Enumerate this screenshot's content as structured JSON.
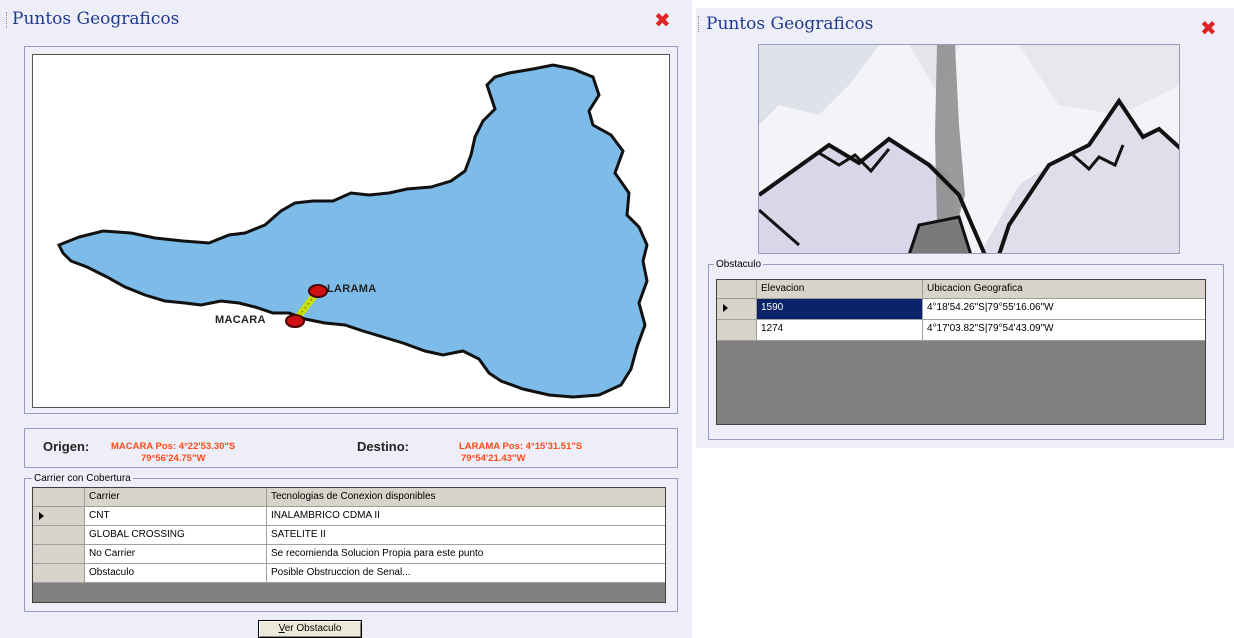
{
  "left_window": {
    "title": "Puntos Geograficos",
    "map": {
      "origin_label": "MACARA",
      "destination_label": "LARAMA",
      "land_color": "#7dbbe8",
      "link_color": "#c8e000"
    },
    "route": {
      "origin_label": "Origen:",
      "origin_value_1": "MACARA Pos:   4°22'53.30\"S",
      "origin_value_2": "79°56'24.75\"W",
      "destination_label": "Destino:",
      "destination_value_1": "LARAMA Pos:   4°15'31.51\"S",
      "destination_value_2": "79°54'21.43\"W"
    },
    "carriers": {
      "legend": "Carrier con Cobertura",
      "columns": [
        "Carrier",
        "Tecnologias de Conexion disponibles"
      ],
      "rows": [
        [
          "CNT",
          "INALAMBRICO CDMA II"
        ],
        [
          "GLOBAL CROSSING",
          "SATELITE II"
        ],
        [
          "No Carrier",
          "Se recomienda Solucion Propia para este punto"
        ],
        [
          "Obstaculo",
          "Posible Obstruccion de Senal..."
        ]
      ],
      "selected_row": 0
    },
    "button": {
      "mnemonic": "V",
      "label_rest": "er Obstaculo"
    }
  },
  "right_window": {
    "title": "Puntos Geograficos",
    "obstacles": {
      "legend": "Obstaculo",
      "columns": [
        "Elevacion",
        "Ubicacion Geografica"
      ],
      "rows": [
        [
          "1590",
          "4°18'54.26\"S|79°55'16.06\"W"
        ],
        [
          "1274",
          "4°17'03.82\"S|79°54'43.09\"W"
        ]
      ],
      "selected_row": 0
    }
  },
  "icons": {
    "close": "close-x-icon",
    "row_selector": "row-selector-arrow-icon"
  },
  "colors": {
    "title_blue": "#1f3a8f",
    "close_red": "#e02424",
    "route_orange": "#ff4a1a",
    "selection_navy": "#0a246a"
  }
}
